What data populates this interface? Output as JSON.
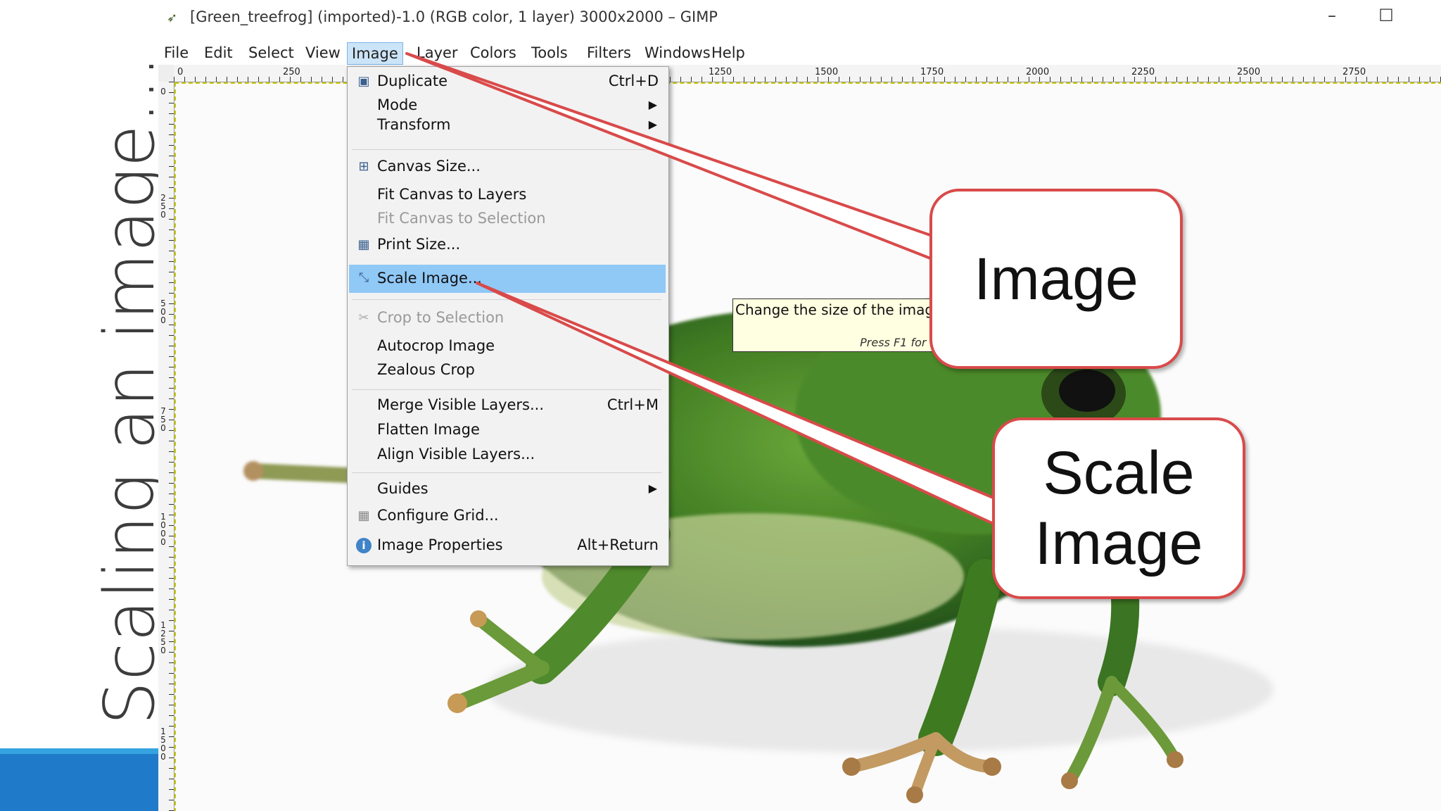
{
  "slide": {
    "title": "Scaling an image…"
  },
  "window": {
    "title": "[Green_treefrog] (imported)-1.0 (RGB color, 1 layer) 3000x2000 – GIMP",
    "minimize": "–",
    "maximize": "☐"
  },
  "menubar": [
    {
      "label": "File"
    },
    {
      "label": "Edit"
    },
    {
      "label": "Select"
    },
    {
      "label": "View"
    },
    {
      "label": "Image"
    },
    {
      "label": "Layer"
    },
    {
      "label": "Colors"
    },
    {
      "label": "Tools"
    },
    {
      "label": "Filters"
    },
    {
      "label": "Windows"
    },
    {
      "label": "Help"
    }
  ],
  "ruler": {
    "top_ticks": [
      "0",
      "250",
      "1250",
      "1500",
      "1750",
      "2000",
      "2250",
      "2500",
      "2750"
    ],
    "left_ticks": [
      "0",
      "250",
      "500",
      "750",
      "1000",
      "1250",
      "1500"
    ]
  },
  "image_menu": {
    "items": [
      {
        "label": "Duplicate",
        "shortcut": "Ctrl+D"
      },
      {
        "label": "Mode"
      },
      {
        "label": "Transform"
      },
      {
        "label": "Canvas Size..."
      },
      {
        "label": "Fit Canvas to Layers"
      },
      {
        "label": "Fit Canvas to Selection"
      },
      {
        "label": "Print Size..."
      },
      {
        "label": "Scale Image..."
      },
      {
        "label": "Crop to Selection"
      },
      {
        "label": "Autocrop Image"
      },
      {
        "label": "Zealous Crop"
      },
      {
        "label": "Merge Visible Layers...",
        "shortcut": "Ctrl+M"
      },
      {
        "label": "Flatten Image"
      },
      {
        "label": "Align Visible Layers..."
      },
      {
        "label": "Guides"
      },
      {
        "label": "Configure Grid..."
      },
      {
        "label": "Image Properties",
        "shortcut": "Alt+Return"
      }
    ]
  },
  "tooltip": {
    "text": "Change the size of the image content",
    "help": "Press F1 for more help"
  },
  "callouts": {
    "image": "Image",
    "scale_line1": "Scale",
    "scale_line2": "Image"
  },
  "colors": {
    "accent_blue": "#1f7ac9",
    "accent_light_blue": "#35a3df",
    "callout_border": "#d94a4a",
    "menu_highlight": "#90c8f6",
    "tooltip_bg": "#ffffe1"
  }
}
